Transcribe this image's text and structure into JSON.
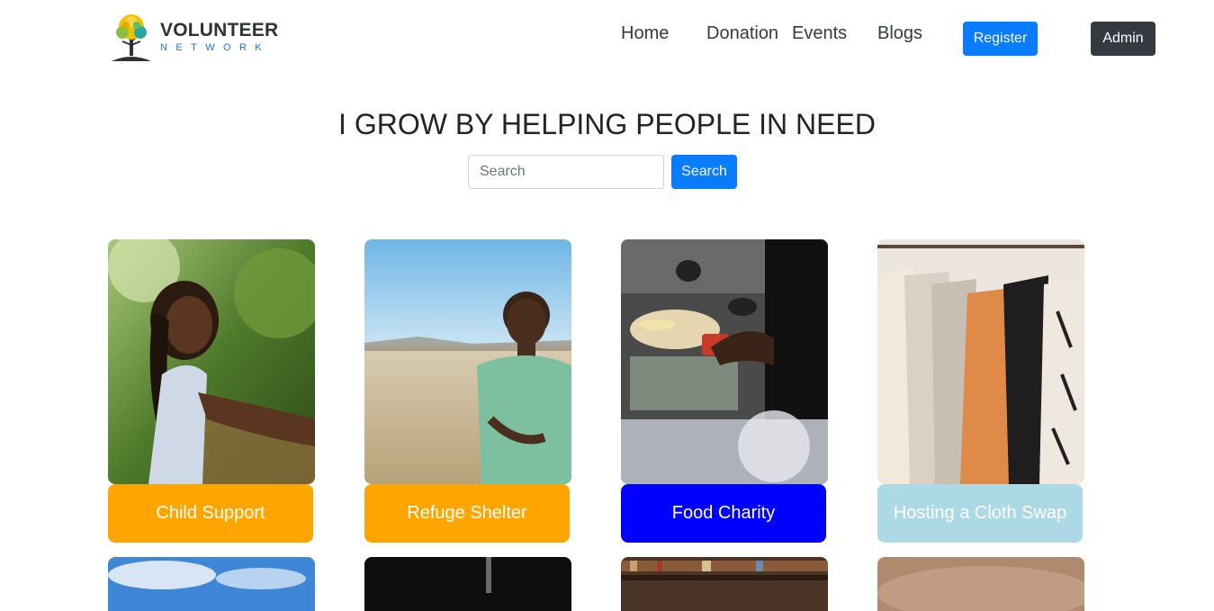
{
  "brand": {
    "title": "VOLUNTEER",
    "subtitle": "NETWORK"
  },
  "nav": {
    "home": "Home",
    "donation": "Donation",
    "events": "Events",
    "blogs": "Blogs"
  },
  "buttons": {
    "register": "Register",
    "admin": "Admin",
    "search": "Search"
  },
  "hero": {
    "title": "I GROW BY HELPING PEOPLE IN NEED"
  },
  "search": {
    "placeholder": "Search",
    "value": ""
  },
  "cards": [
    {
      "label": "Child Support",
      "color": "#ffa500",
      "image": "girl-smiling-outdoors"
    },
    {
      "label": "Refuge Shelter",
      "color": "#ffa500",
      "image": "boy-in-field"
    },
    {
      "label": "Food Charity",
      "color": "#0000ff",
      "image": "food-distribution-table"
    },
    {
      "label": "Hosting a Cloth Swap",
      "color": "#add8e6",
      "image": "clothes-rack"
    }
  ],
  "colors": {
    "primary": "#0a7cff",
    "dark": "#343a40"
  }
}
